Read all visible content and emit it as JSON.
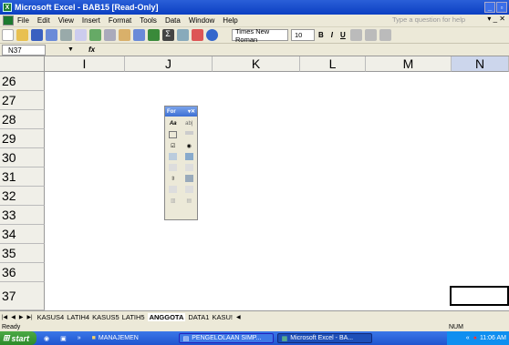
{
  "window": {
    "title": "Microsoft Excel - BAB15 [Read-Only]"
  },
  "menu": {
    "items": [
      "File",
      "Edit",
      "View",
      "Insert",
      "Format",
      "Tools",
      "Data",
      "Window",
      "Help"
    ],
    "help_placeholder": "Type a question for help"
  },
  "toolbar": {
    "font_name": "Times New Roman",
    "font_size": "10",
    "bold": "B",
    "italic": "I",
    "underline": "U"
  },
  "formula": {
    "name_box": "N37",
    "fx": "fx"
  },
  "columns": [
    "I",
    "J",
    "K",
    "L",
    "M",
    "N"
  ],
  "rows": [
    "26",
    "27",
    "28",
    "29",
    "30",
    "31",
    "32",
    "33",
    "34",
    "35",
    "36",
    "37"
  ],
  "forms_toolbar": {
    "title": "For",
    "label_icon": "Aa",
    "textfield_icon": "ab|"
  },
  "sheets": {
    "tabs": [
      "KASUS4",
      "LATIH4",
      "KASUS5",
      "LATIH5",
      "ANGGOTA",
      "DATA1",
      "KASU!"
    ],
    "active": "ANGGOTA"
  },
  "status": {
    "left": "Ready",
    "num": "NUM"
  },
  "taskbar": {
    "start": "start",
    "items": [
      "MANAJEMEN",
      "PENGELOLAAN SIMP...",
      "Microsoft Excel - BA..."
    ],
    "clock": "11:06 AM"
  }
}
